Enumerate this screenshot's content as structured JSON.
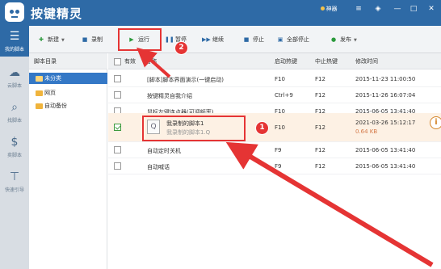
{
  "app": {
    "title": "按键精灵",
    "pin_label": "神器"
  },
  "window_controls": {
    "menu": "≡",
    "skin": "◈",
    "min": "—",
    "max": "□",
    "close": "✕"
  },
  "leftnav": [
    {
      "label": "我的脚本",
      "icon": "☰"
    },
    {
      "label": "云脚本",
      "icon": "☁"
    },
    {
      "label": "找脚本",
      "icon": "⌕"
    },
    {
      "label": "卖脚本",
      "icon": "$"
    },
    {
      "label": "快速引导",
      "icon": "⊤"
    }
  ],
  "toolbar": {
    "new": "新建",
    "record": "录制",
    "run": "运行",
    "stop": "暂停",
    "resume": "继续",
    "halt": "停止",
    "halt_all": "全部停止",
    "publish": "发布"
  },
  "annotations": {
    "step1": "1",
    "step2": "2"
  },
  "folder_panel": {
    "header": "脚本目录",
    "folders": [
      "未分类",
      "网页",
      "自动备份"
    ]
  },
  "table": {
    "headers": {
      "enabled": "有效",
      "name": "名称",
      "start_key": "启动热键",
      "stop_key": "中止热键",
      "modified": "修改时间"
    },
    "rows": [
      {
        "name": "[脚本]脚本界面演示(一键启动)",
        "start": "F10",
        "stop": "F12",
        "time": "2015-11-23 11:00:50",
        "checked": false
      },
      {
        "name": "按键精灵自我介绍",
        "start": "Ctrl+9",
        "stop": "F12",
        "time": "2015-11-26 16:07:04",
        "checked": false
      },
      {
        "name": "鼠标左键连点器(可调频率)",
        "start": "F10",
        "stop": "F12",
        "time": "2015-06-05 13:41:40",
        "checked": false
      },
      {
        "name": "我录制的脚本1",
        "subtitle": "我录制的脚本1.Q",
        "start": "F10",
        "stop": "F12",
        "time": "2021-03-26 15:12:17",
        "size": "0.64 KB",
        "checked": true
      },
      {
        "name": "自动定时关机",
        "start": "F9",
        "stop": "F12",
        "time": "2015-06-05 13:41:40",
        "checked": false
      },
      {
        "name": "自动喊话",
        "start": "F9",
        "stop": "F12",
        "time": "2015-06-05 13:41:40",
        "checked": false
      }
    ]
  },
  "colors": {
    "brand": "#2e6aa6",
    "highlight": "#e53434",
    "selected_row": "#fdf1e4"
  }
}
